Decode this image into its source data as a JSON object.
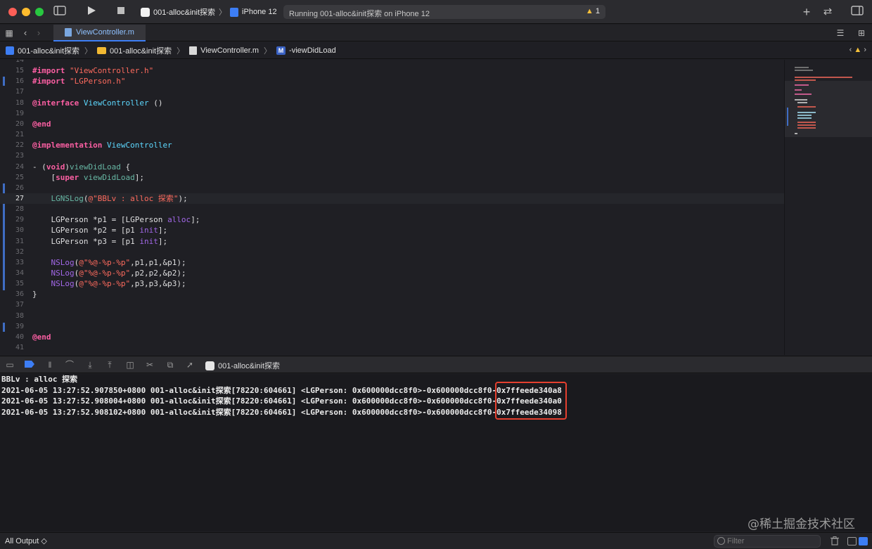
{
  "toolbar": {
    "scheme_project": "001-alloc&init探索",
    "scheme_sep": "〉",
    "scheme_device": "iPhone 12",
    "status_text": "Running 001-alloc&init探索 on iPhone 12",
    "warning_count": "1",
    "icons": [
      "sidebar-toggle-icon",
      "run-icon",
      "stop-icon",
      "plus-icon",
      "swap-icon",
      "inspector-toggle-icon"
    ]
  },
  "tab": {
    "label": "ViewController.m"
  },
  "jumpbar": {
    "items": [
      "001-alloc&init探索",
      "001-alloc&init探索",
      "ViewController.m",
      "-viewDidLoad"
    ],
    "sep": "〉"
  },
  "editor": {
    "current_line": "27",
    "lines": [
      {
        "n": "14",
        "t": ""
      },
      {
        "n": "15",
        "t": "#import \"ViewController.h\""
      },
      {
        "n": "16",
        "t": "#import \"LGPerson.h\""
      },
      {
        "n": "17",
        "t": ""
      },
      {
        "n": "18",
        "t": "@interface ViewController ()"
      },
      {
        "n": "19",
        "t": ""
      },
      {
        "n": "20",
        "t": "@end"
      },
      {
        "n": "21",
        "t": ""
      },
      {
        "n": "22",
        "t": "@implementation ViewController"
      },
      {
        "n": "23",
        "t": ""
      },
      {
        "n": "24",
        "t": "- (void)viewDidLoad {"
      },
      {
        "n": "25",
        "t": "    [super viewDidLoad];"
      },
      {
        "n": "26",
        "t": ""
      },
      {
        "n": "27",
        "t": "    LGNSLog(@\"BBLv : alloc 探索\");"
      },
      {
        "n": "28",
        "t": ""
      },
      {
        "n": "29",
        "t": "    LGPerson *p1 = [LGPerson alloc];"
      },
      {
        "n": "30",
        "t": "    LGPerson *p2 = [p1 init];"
      },
      {
        "n": "31",
        "t": "    LGPerson *p3 = [p1 init];"
      },
      {
        "n": "32",
        "t": ""
      },
      {
        "n": "33",
        "t": "    NSLog(@\"%@-%p-%p\",p1,p1,&p1);"
      },
      {
        "n": "34",
        "t": "    NSLog(@\"%@-%p-%p\",p2,p2,&p2);"
      },
      {
        "n": "35",
        "t": "    NSLog(@\"%@-%p-%p\",p3,p3,&p3);"
      },
      {
        "n": "36",
        "t": "}"
      },
      {
        "n": "37",
        "t": ""
      },
      {
        "n": "38",
        "t": ""
      },
      {
        "n": "39",
        "t": ""
      },
      {
        "n": "40",
        "t": "@end"
      },
      {
        "n": "41",
        "t": ""
      }
    ]
  },
  "debugbar": {
    "scheme": "001-alloc&init探索"
  },
  "console": {
    "lines": [
      "BBLv : alloc 探索",
      "2021-06-05 13:27:52.907850+0800 001-alloc&init探索[78220:604661] <LGPerson: 0x600000dcc8f0>-0x600000dcc8f0-0x7ffeede340a8",
      "2021-06-05 13:27:52.908004+0800 001-alloc&init探索[78220:604661] <LGPerson: 0x600000dcc8f0>-0x600000dcc8f0-0x7ffeede340a0",
      "2021-06-05 13:27:52.908102+0800 001-alloc&init探索[78220:604661] <LGPerson: 0x600000dcc8f0>-0x600000dcc8f0-0x7ffeede34098"
    ],
    "watermark": "@稀土掘金技术社区"
  },
  "bottombar": {
    "output_selector": "All Output ◇",
    "filter_placeholder": "Filter"
  },
  "colors": {
    "keyword": "#fc5fa3",
    "string": "#fc6a5d",
    "class": "#5dd8ff",
    "highlight_box": "#e5402f",
    "accent": "#3d7ef5"
  }
}
